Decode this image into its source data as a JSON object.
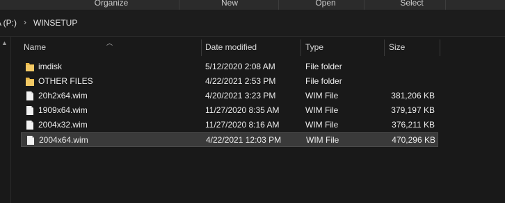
{
  "ribbon": {
    "groups": [
      "Organize",
      "New",
      "Open",
      "Select"
    ]
  },
  "address": {
    "drive_fragment": "A (P:)",
    "current": "WINSETUP",
    "separator": "›"
  },
  "columns": {
    "name": "Name",
    "date": "Date modified",
    "type": "Type",
    "size": "Size"
  },
  "files": [
    {
      "name": "imdisk",
      "date": "5/12/2020 2:08 AM",
      "type": "File folder",
      "size": "",
      "kind": "folder-icon"
    },
    {
      "name": "OTHER FILES",
      "date": "4/22/2021 2:53 PM",
      "type": "File folder",
      "size": "",
      "kind": "folder-icon"
    },
    {
      "name": "20h2x64.wim",
      "date": "4/20/2021 3:23 PM",
      "type": "WIM File",
      "size": "381,206 KB",
      "kind": "file-icon"
    },
    {
      "name": "1909x64.wim",
      "date": "11/27/2020 8:35 AM",
      "type": "WIM File",
      "size": "379,197 KB",
      "kind": "file-icon"
    },
    {
      "name": "2004x32.wim",
      "date": "11/27/2020 8:16 AM",
      "type": "WIM File",
      "size": "376,211 KB",
      "kind": "file-icon"
    },
    {
      "name": "2004x64.wim",
      "date": "4/22/2021 12:03 PM",
      "type": "WIM File",
      "size": "470,296 KB",
      "kind": "file-icon",
      "selected": true
    }
  ],
  "colors": {
    "background": "#191919",
    "folder": "#e8b84a",
    "selected_row": "#3a3a3a"
  }
}
